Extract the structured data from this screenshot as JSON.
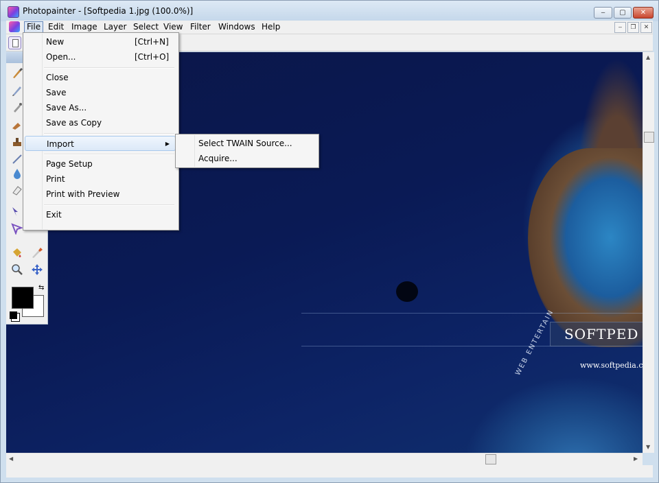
{
  "window": {
    "title": "Photopainter - [Softpedia 1.jpg  (100.0%)]",
    "buttons": {
      "minimize": "‒",
      "maximize": "▢",
      "close": "✕"
    }
  },
  "menubar": {
    "items": [
      "File",
      "Edit",
      "Image",
      "Layer",
      "Select",
      "View",
      "Filter",
      "Windows",
      "Help"
    ],
    "active": "File",
    "mdi_buttons": {
      "minimize": "‒",
      "restore": "❐",
      "close": "✕"
    }
  },
  "file_menu": {
    "items": [
      {
        "label": "New",
        "shortcut": "[Ctrl+N]"
      },
      {
        "label": "Open...",
        "shortcut": "[Ctrl+O]"
      },
      {
        "label": "Close",
        "shortcut": ""
      },
      {
        "label": "Save",
        "shortcut": ""
      },
      {
        "label": "Save As...",
        "shortcut": ""
      },
      {
        "label": "Save as Copy",
        "shortcut": ""
      },
      {
        "label": "Import",
        "shortcut": "",
        "submenu": true
      },
      {
        "label": "Page Setup",
        "shortcut": ""
      },
      {
        "label": "Print",
        "shortcut": ""
      },
      {
        "label": "Print with Preview",
        "shortcut": ""
      },
      {
        "label": "Exit",
        "shortcut": ""
      }
    ],
    "highlighted": "Import"
  },
  "import_submenu": {
    "items": [
      "Select TWAIN Source...",
      "Acquire..."
    ]
  },
  "canvas": {
    "watermark_text": "SOFTPED",
    "url_text": "www.softpedia.com",
    "curved_text": "WEB  ENTERTAIN"
  },
  "colors": {
    "foreground": "#000000",
    "background": "#ffffff",
    "menu_highlight": "#dce9f8",
    "close_button": "#c8452e"
  },
  "toolbox": {
    "tools": [
      "paintbrush-icon",
      "pencil-icon",
      "airbrush-icon",
      "smudge-icon",
      "stamp-icon",
      "line-icon",
      "blur-drop-icon",
      "eraser-icon",
      "lasso-select-icon",
      "polygon-select-icon",
      "paint-bucket-icon",
      "color-picker-icon",
      "zoom-icon",
      "move-icon"
    ]
  }
}
